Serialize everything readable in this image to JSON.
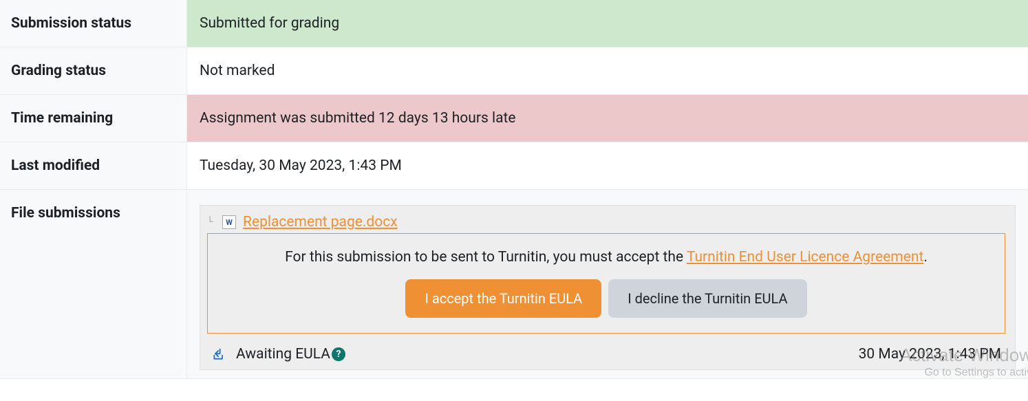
{
  "rows": {
    "submission_status": {
      "label": "Submission status",
      "value": "Submitted for grading"
    },
    "grading_status": {
      "label": "Grading status",
      "value": "Not marked"
    },
    "time_remaining": {
      "label": "Time remaining",
      "value": "Assignment was submitted 12 days 13 hours late"
    },
    "last_modified": {
      "label": "Last modified",
      "value": "Tuesday, 30 May 2023, 1:43 PM"
    },
    "file_submissions": {
      "label": "File submissions"
    }
  },
  "file": {
    "name": "Replacement page.docx"
  },
  "eula": {
    "text_prefix": "For this submission to be sent to Turnitin, you must accept the ",
    "link_text": "Turnitin End User Licence Agreement",
    "text_suffix": ".",
    "accept_label": "I accept the Turnitin EULA",
    "decline_label": "I decline the Turnitin EULA"
  },
  "status": {
    "awaiting": "Awaiting EULA",
    "date": "30 May 2023, 1:43 PM"
  },
  "watermark": {
    "line1": "Activate Window",
    "line2": "Go to Settings to activ"
  }
}
